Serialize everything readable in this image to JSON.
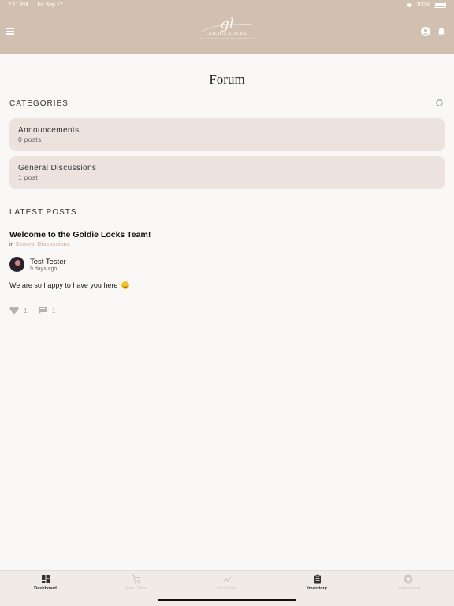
{
  "status_bar": {
    "time": "2:11 PM",
    "date": "Fri Sep 17",
    "battery": "100%"
  },
  "header": {
    "logo_mark": "gl",
    "logo_text": "GOLDIE LOCKS",
    "logo_sub": "THE LUXURY EXTENSION EXPERIENCE"
  },
  "page": {
    "title": "Forum"
  },
  "categories": {
    "label": "CATEGORIES",
    "items": [
      {
        "name": "Announcements",
        "count": "0 posts"
      },
      {
        "name": "General Discussions",
        "count": "1 post"
      }
    ]
  },
  "latest": {
    "label": "LATEST POSTS",
    "post": {
      "title": "Welcome to the Goldie Locks Team!",
      "in_prefix": "in",
      "category": "General Discussions",
      "author": "Test Tester",
      "time": "9 days ago",
      "body": "We are so happy to have you here",
      "likes": "1",
      "comments": "1"
    }
  },
  "tabs": [
    {
      "label": "Dashboard",
      "icon": "dashboard-icon",
      "active": true
    },
    {
      "label": "New Order",
      "icon": "cart-icon",
      "active": false
    },
    {
      "label": "Your Sales",
      "icon": "chart-icon",
      "active": false
    },
    {
      "label": "Inventory",
      "icon": "clipboard-icon",
      "active": true
    },
    {
      "label": "Leaderboard",
      "icon": "star-badge-icon",
      "active": false
    }
  ],
  "colors": {
    "header": "#d1bfaf",
    "card": "#ece3de",
    "accent": "#d6bfa8",
    "background": "#faf8f6"
  }
}
